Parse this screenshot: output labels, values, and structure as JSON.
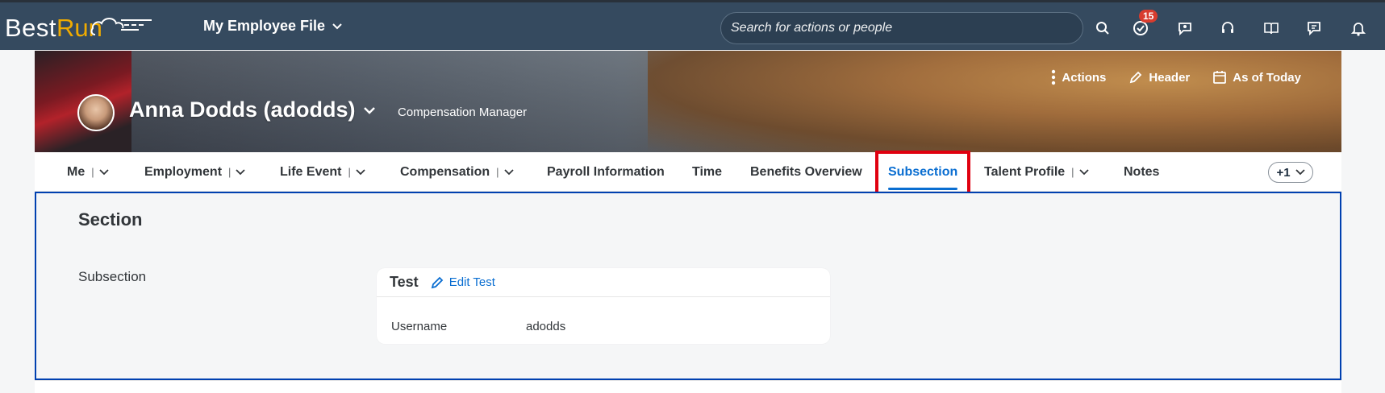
{
  "shell": {
    "logo_best": "Best",
    "logo_run": "Run",
    "app_title": "My Employee File",
    "search_placeholder": "Search for actions or people",
    "notification_count": "15",
    "icons": [
      "search-icon",
      "todo-icon",
      "chat-icon",
      "support-icon",
      "guide-icon",
      "feedback-icon",
      "bell-icon"
    ]
  },
  "employee": {
    "name": "Anna Dodds (adodds)",
    "role": "Compensation Manager",
    "actions": [
      {
        "label": "Actions",
        "icon": "more-vertical-icon"
      },
      {
        "label": "Header",
        "icon": "pencil-icon"
      },
      {
        "label": "As of Today",
        "icon": "calendar-icon"
      }
    ]
  },
  "tabs": [
    {
      "label": "Me",
      "dropdown": true
    },
    {
      "label": "Employment",
      "dropdown": true
    },
    {
      "label": "Life Event",
      "dropdown": true
    },
    {
      "label": "Compensation",
      "dropdown": true
    },
    {
      "label": "Payroll Information",
      "dropdown": false
    },
    {
      "label": "Time",
      "dropdown": false
    },
    {
      "label": "Benefits Overview",
      "dropdown": false
    },
    {
      "label": "Subsection",
      "dropdown": false,
      "active": true
    },
    {
      "label": "Talent Profile",
      "dropdown": true
    },
    {
      "label": "Notes",
      "dropdown": false
    }
  ],
  "more_tabs": "+1",
  "section": {
    "title": "Section",
    "subsection_label": "Subsection",
    "card": {
      "title": "Test",
      "edit_label": "Edit Test",
      "field_label": "Username",
      "field_value": "adodds"
    }
  },
  "colors": {
    "shell_bg": "#354a5f",
    "accent": "#0a6ed1",
    "highlight": "#e0000f",
    "logo_run": "#f0ab00"
  }
}
